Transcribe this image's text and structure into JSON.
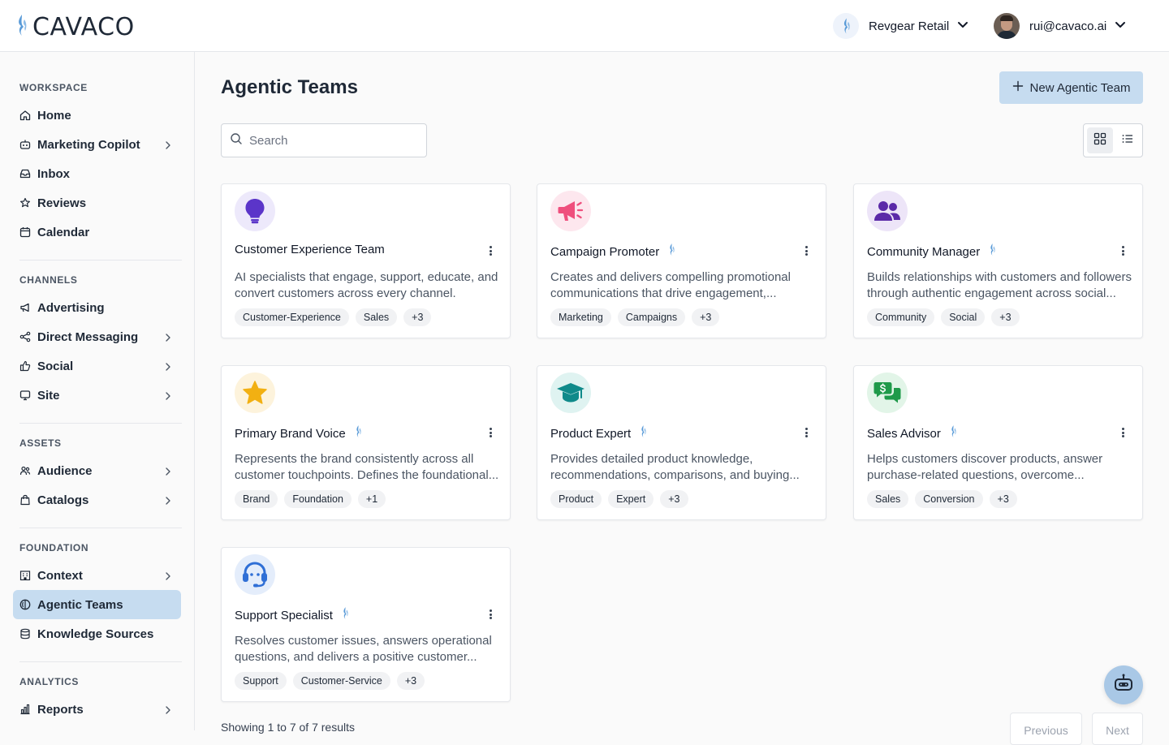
{
  "brand": {
    "name": "CAVACO",
    "accent": "#c6dcf0"
  },
  "header": {
    "org_name": "Revgear Retail",
    "user_email": "rui@cavaco.ai"
  },
  "sidebar": {
    "sections": [
      {
        "title": "WORKSPACE",
        "items": [
          {
            "label": "Home",
            "icon": "home-icon",
            "has_arrow": false
          },
          {
            "label": "Marketing Copilot",
            "icon": "bot-icon",
            "has_arrow": true
          },
          {
            "label": "Inbox",
            "icon": "inbox-icon",
            "has_arrow": false
          },
          {
            "label": "Reviews",
            "icon": "star-icon",
            "has_arrow": false
          },
          {
            "label": "Calendar",
            "icon": "calendar-icon",
            "has_arrow": false
          }
        ]
      },
      {
        "title": "CHANNELS",
        "items": [
          {
            "label": "Advertising",
            "icon": "megaphone-icon",
            "has_arrow": false
          },
          {
            "label": "Direct Messaging",
            "icon": "share-icon",
            "has_arrow": true
          },
          {
            "label": "Social",
            "icon": "thumbs-up-icon",
            "has_arrow": true
          },
          {
            "label": "Site",
            "icon": "monitor-icon",
            "has_arrow": true
          }
        ]
      },
      {
        "title": "ASSETS",
        "items": [
          {
            "label": "Audience",
            "icon": "users-icon",
            "has_arrow": true
          },
          {
            "label": "Catalogs",
            "icon": "shopping-bag-icon",
            "has_arrow": true
          }
        ]
      },
      {
        "title": "FOUNDATION",
        "items": [
          {
            "label": "Context",
            "icon": "building-icon",
            "has_arrow": true
          },
          {
            "label": "Agentic Teams",
            "icon": "agent-icon",
            "has_arrow": false,
            "active": true
          },
          {
            "label": "Knowledge Sources",
            "icon": "database-icon",
            "has_arrow": false
          }
        ]
      },
      {
        "title": "ANALYTICS",
        "items": [
          {
            "label": "Reports",
            "icon": "bar-chart-icon",
            "has_arrow": true
          }
        ]
      }
    ]
  },
  "main": {
    "title": "Agentic Teams",
    "new_button_label": "New Agentic Team",
    "search_placeholder": "Search",
    "view_mode": "grid",
    "cards": [
      {
        "title": "Customer Experience Team",
        "flame": false,
        "icon": "lightbulb-icon",
        "icon_color": "#5b35c9",
        "icon_bg": "#ede9fb",
        "description": "AI specialists that engage, support, educate, and convert customers across every channel.",
        "tags": [
          "Customer-Experience",
          "Sales",
          "+3"
        ]
      },
      {
        "title": "Campaign Promoter",
        "flame": true,
        "icon": "megaphone-icon",
        "icon_color": "#ef4f7d",
        "icon_bg": "#fde7ee",
        "description": "Creates and delivers compelling promotional communications that drive engagement,...",
        "tags": [
          "Marketing",
          "Campaigns",
          "+3"
        ]
      },
      {
        "title": "Community Manager",
        "flame": true,
        "icon": "users-icon",
        "icon_color": "#5b2aa8",
        "icon_bg": "#ede5f8",
        "description": "Builds relationships with customers and followers through authentic engagement across social...",
        "tags": [
          "Community",
          "Social",
          "+3"
        ]
      },
      {
        "title": "Primary Brand Voice",
        "flame": true,
        "icon": "star-icon",
        "icon_color": "#f2b012",
        "icon_bg": "#fdf3dc",
        "description": "Represents the brand consistently across all customer touchpoints. Defines the foundational...",
        "tags": [
          "Brand",
          "Foundation",
          "+1"
        ]
      },
      {
        "title": "Product Expert",
        "flame": true,
        "icon": "graduation-cap-icon",
        "icon_color": "#0f8a8a",
        "icon_bg": "#dff3f1",
        "description": "Provides detailed product knowledge, recommendations, comparisons, and buying...",
        "tags": [
          "Product",
          "Expert",
          "+3"
        ]
      },
      {
        "title": "Sales Advisor",
        "flame": true,
        "icon": "money-chat-icon",
        "icon_color": "#1f9a4a",
        "icon_bg": "#e2f5e8",
        "description": "Helps customers discover products, answer purchase-related questions, overcome...",
        "tags": [
          "Sales",
          "Conversion",
          "+3"
        ]
      },
      {
        "title": "Support Specialist",
        "flame": true,
        "icon": "headset-icon",
        "icon_color": "#2f6fd6",
        "icon_bg": "#e4edfb",
        "description": "Resolves customer issues, answers operational questions, and delivers a positive customer...",
        "tags": [
          "Support",
          "Customer-Service",
          "+3"
        ]
      }
    ],
    "results_text": "Showing 1 to 7 of 7 results",
    "pagination": {
      "previous": "Previous",
      "next": "Next"
    }
  }
}
